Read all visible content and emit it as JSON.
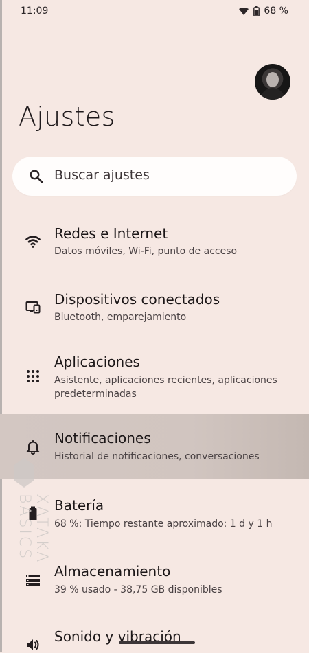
{
  "status_bar": {
    "time": "11:09",
    "battery": "68 %"
  },
  "header": {
    "title": "Ajustes",
    "avatar_label": "profile avatar"
  },
  "search": {
    "placeholder": "Buscar ajustes"
  },
  "settings": [
    {
      "id": "redes",
      "title": "Redes e Internet",
      "subtitle": "Datos móviles, Wi-Fi, punto de acceso",
      "icon": "wifi-icon"
    },
    {
      "id": "dispositivos",
      "title": "Dispositivos conectados",
      "subtitle": "Bluetooth, emparejamiento",
      "icon": "connected-devices-icon"
    },
    {
      "id": "aplicaciones",
      "title": "Aplicaciones",
      "subtitle": "Asistente, aplicaciones recientes, aplicaciones predeterminadas",
      "icon": "apps-grid-icon"
    },
    {
      "id": "notificaciones",
      "title": "Notificaciones",
      "subtitle": "Historial de notificaciones, conversaciones",
      "icon": "bell-icon"
    },
    {
      "id": "bateria",
      "title": "Batería",
      "subtitle": "68 %: Tiempo restante aproximado: 1 d y 1 h",
      "icon": "battery-icon"
    },
    {
      "id": "almacenamiento",
      "title": "Almacenamiento",
      "subtitle": "39 % usado - 38,75 GB disponibles",
      "icon": "storage-icon"
    },
    {
      "id": "sonido",
      "title": "Sonido y vibración",
      "subtitle": "",
      "icon": "sound-icon"
    }
  ],
  "watermark": {
    "text": "XATAKA BASICS"
  },
  "colors": {
    "background": "#f6e8e3",
    "search_bg": "#fffdfc",
    "highlight": "#d3c7c2",
    "text": "#1f1a1c"
  }
}
